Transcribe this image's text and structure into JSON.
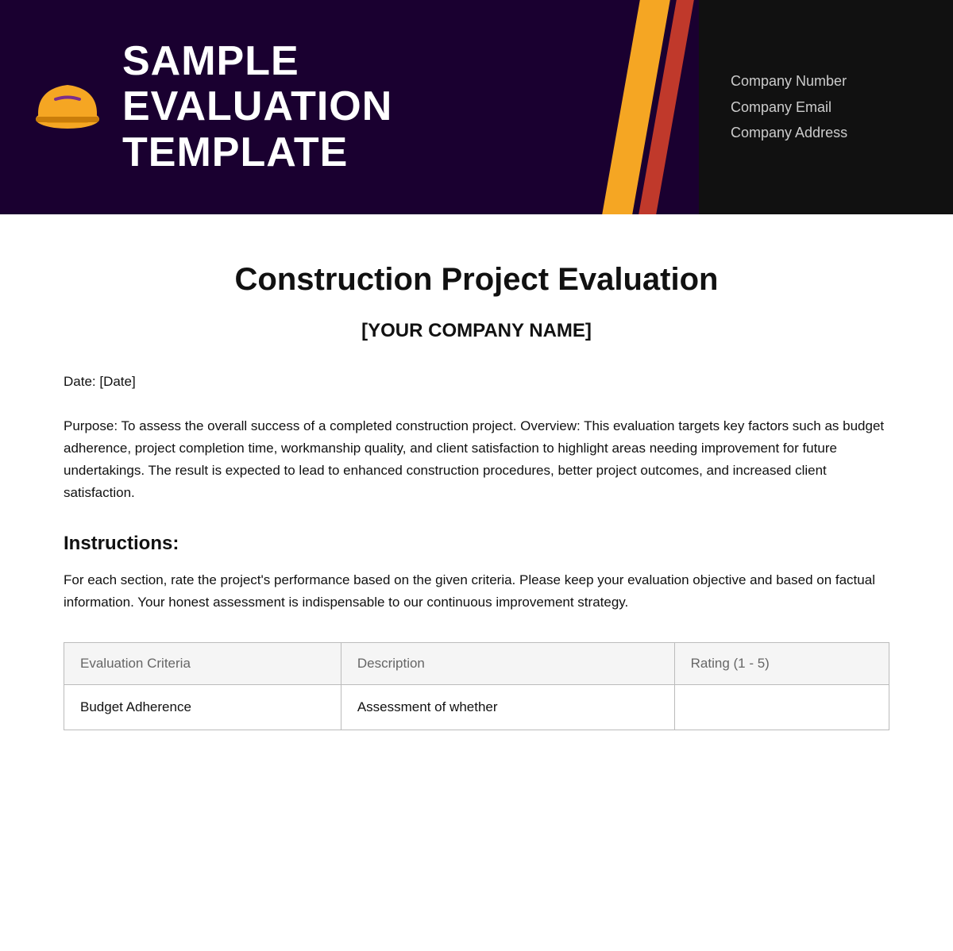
{
  "header": {
    "title_line1": "SAMPLE",
    "title_line2": "EVALUATION",
    "title_line3": "TEMPLATE",
    "company_number_label": "Company Number",
    "company_email_label": "Company Email",
    "company_address_label": "Company Address"
  },
  "document": {
    "title": "Construction Project Evaluation",
    "subtitle": "[YOUR COMPANY NAME]",
    "date_label": "Date: [Date]",
    "purpose_text": "Purpose: To assess the overall success of a completed construction project. Overview: This evaluation targets key factors such as budget adherence, project completion time, workmanship quality, and client satisfaction to highlight areas needing improvement for future undertakings. The result is expected to lead to enhanced construction procedures, better project outcomes, and increased client satisfaction.",
    "instructions_heading": "Instructions:",
    "instructions_text": "For each section, rate the project's performance based on the given criteria. Please keep your evaluation objective and based on factual information. Your honest assessment is indispensable to our continuous improvement strategy."
  },
  "table": {
    "headers": [
      "Evaluation Criteria",
      "Description",
      "Rating (1 - 5)"
    ],
    "rows": [
      {
        "criteria": "Budget Adherence",
        "description": "Assessment of whether",
        "rating": ""
      }
    ]
  }
}
